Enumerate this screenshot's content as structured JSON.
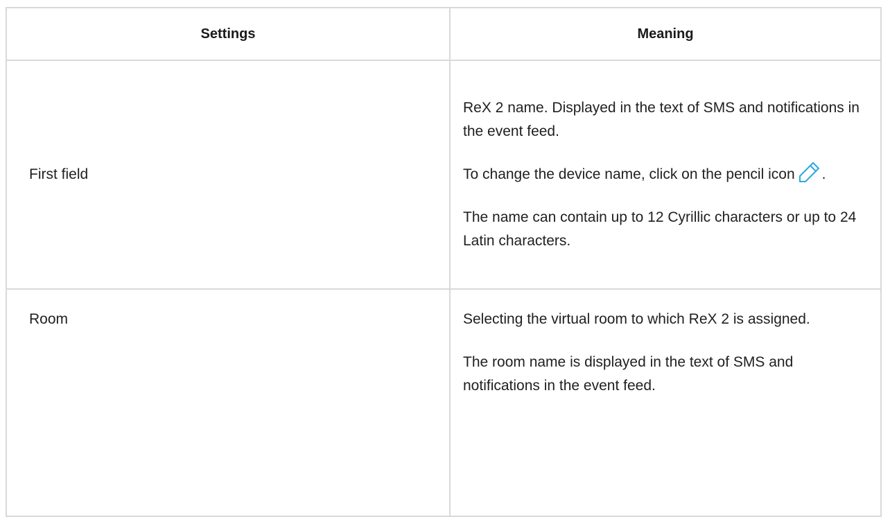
{
  "table": {
    "headers": {
      "settings": "Settings",
      "meaning": "Meaning"
    },
    "rows": [
      {
        "setting": "First field",
        "meaning": {
          "p1": "ReX 2 name. Displayed in the text of SMS and notifications in the event feed.",
          "p2_before_icon": "To change the device name, click on the pencil icon",
          "p2_after_icon": ".",
          "p3": "The name can contain up to 12 Cyrillic characters or up to 24 Latin characters."
        }
      },
      {
        "setting": "Room",
        "meaning": {
          "p1": "Selecting the virtual room to which ReX 2 is assigned.",
          "p2": "The room name is displayed in the text of SMS and notifications in the event feed."
        }
      }
    ]
  },
  "icons": {
    "pencil": "pencil-icon"
  },
  "colors": {
    "border": "#d9d9d9",
    "icon_accent": "#2aa8e0",
    "text": "#1f1f1f"
  }
}
